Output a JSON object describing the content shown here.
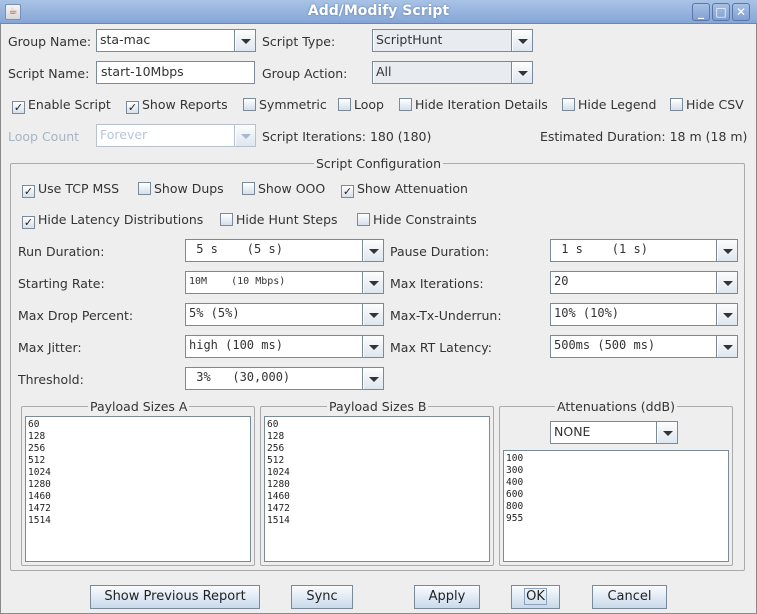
{
  "window": {
    "title": "Add/Modify Script",
    "controls": {
      "minimize": "minimize-icon",
      "maximize": "maximize-icon",
      "close": "close-icon"
    }
  },
  "top": {
    "group_name_label": "Group Name:",
    "group_name_value": "sta-mac",
    "script_type_label": "Script Type:",
    "script_type_value": "ScriptHunt",
    "script_name_label": "Script Name:",
    "script_name_value": "start-10Mbps",
    "group_action_label": "Group Action:",
    "group_action_value": "All",
    "checkboxes": [
      {
        "label": "Enable Script",
        "checked": true
      },
      {
        "label": "Show Reports",
        "checked": true
      },
      {
        "label": "Symmetric",
        "checked": false
      },
      {
        "label": "Loop",
        "checked": false
      },
      {
        "label": "Hide Iteration Details",
        "checked": false
      },
      {
        "label": "Hide Legend",
        "checked": false
      },
      {
        "label": "Hide CSV",
        "checked": false
      }
    ],
    "loop_count_label": "Loop Count",
    "loop_count_value": "Forever",
    "script_iterations": "Script Iterations: 180 (180)",
    "estimated_duration": "Estimated Duration:  18 m (18 m)"
  },
  "config": {
    "title": "Script Configuration",
    "checkboxes_row1": [
      {
        "label": "Use TCP MSS",
        "checked": true
      },
      {
        "label": "Show Dups",
        "checked": false
      },
      {
        "label": "Show OOO",
        "checked": false
      },
      {
        "label": "Show Attenuation",
        "checked": true
      }
    ],
    "checkboxes_row2": [
      {
        "label": "Hide Latency Distributions",
        "checked": true
      },
      {
        "label": "Hide Hunt Steps",
        "checked": false
      },
      {
        "label": "Hide Constraints",
        "checked": false
      }
    ],
    "run_duration": {
      "label": "Run Duration:",
      "value": " 5 s    (5 s)"
    },
    "starting_rate": {
      "label": "Starting Rate:",
      "value": "10M    (10 Mbps)"
    },
    "max_drop_percent": {
      "label": "Max Drop Percent:",
      "value": "5% (5%)"
    },
    "max_jitter": {
      "label": "Max Jitter:",
      "value": "high (100 ms)"
    },
    "threshold": {
      "label": "Threshold:",
      "value": " 3%   (30,000)"
    },
    "pause_duration": {
      "label": "Pause Duration:",
      "value": " 1 s    (1 s)"
    },
    "max_iterations": {
      "label": "Max Iterations:",
      "value": "20"
    },
    "max_tx_underrun": {
      "label": "Max-Tx-Underrun:",
      "value": "10% (10%)"
    },
    "max_rt_latency": {
      "label": "Max RT Latency:",
      "value": "500ms (500 ms)"
    },
    "payload_a": {
      "title": "Payload Sizes A",
      "items": [
        "60",
        "128",
        "256",
        "512",
        "1024",
        "1280",
        "1460",
        "1472",
        "1514"
      ]
    },
    "payload_b": {
      "title": "Payload Sizes B",
      "items": [
        "60",
        "128",
        "256",
        "512",
        "1024",
        "1280",
        "1460",
        "1472",
        "1514"
      ]
    },
    "attenuations": {
      "title": "Attenuations (ddB)",
      "selected": "NONE",
      "items": [
        "100",
        "300",
        "400",
        "600",
        "800",
        "955"
      ]
    }
  },
  "buttons": {
    "show_previous_report": "Show Previous Report",
    "sync": "Sync",
    "apply": "Apply",
    "ok": "OK",
    "cancel": "Cancel"
  }
}
